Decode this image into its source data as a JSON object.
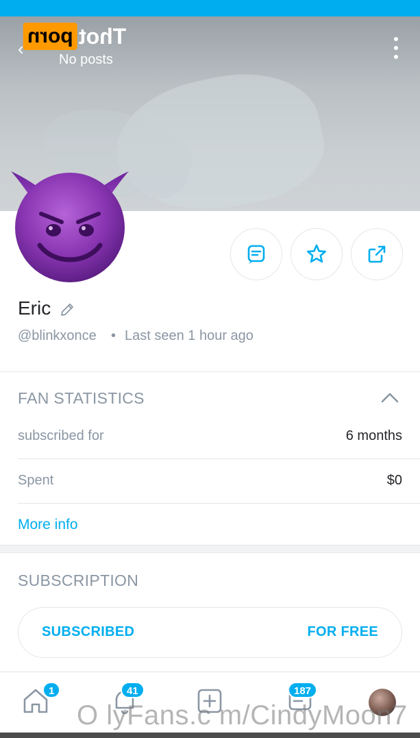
{
  "header": {
    "watermark_logo_box": "porn",
    "watermark_logo_text": "Thot",
    "posts_label": "No posts",
    "back_icon": "arrow-left-icon",
    "more_icon": "more-vertical-icon"
  },
  "profile": {
    "name": "Eric",
    "handle": "@blinkxonce",
    "separator": "•",
    "last_seen": "Last seen 1 hour ago",
    "avatar": "smiling-devil-emoji"
  },
  "actions": [
    {
      "name": "message",
      "icon": "message-icon"
    },
    {
      "name": "favorite",
      "icon": "star-icon"
    },
    {
      "name": "share",
      "icon": "share-icon"
    }
  ],
  "fan_statistics": {
    "title": "FAN STATISTICS",
    "rows": [
      {
        "label": "subscribed for",
        "value": "6 months"
      },
      {
        "label": "Spent",
        "value": "$0"
      }
    ],
    "more_info": "More info"
  },
  "subscription": {
    "title": "SUBSCRIPTION",
    "status": "SUBSCRIBED",
    "price": "FOR FREE"
  },
  "bottom_nav": {
    "home_badge": "1",
    "notifications_badge": "41",
    "messages_badge": "187"
  },
  "watermark": "O lyFans.c m/CindyMoon7",
  "colors": {
    "accent": "#00aeef",
    "muted_text": "#8a96a3",
    "primary_text": "#242529",
    "border": "#e3e6e8"
  }
}
